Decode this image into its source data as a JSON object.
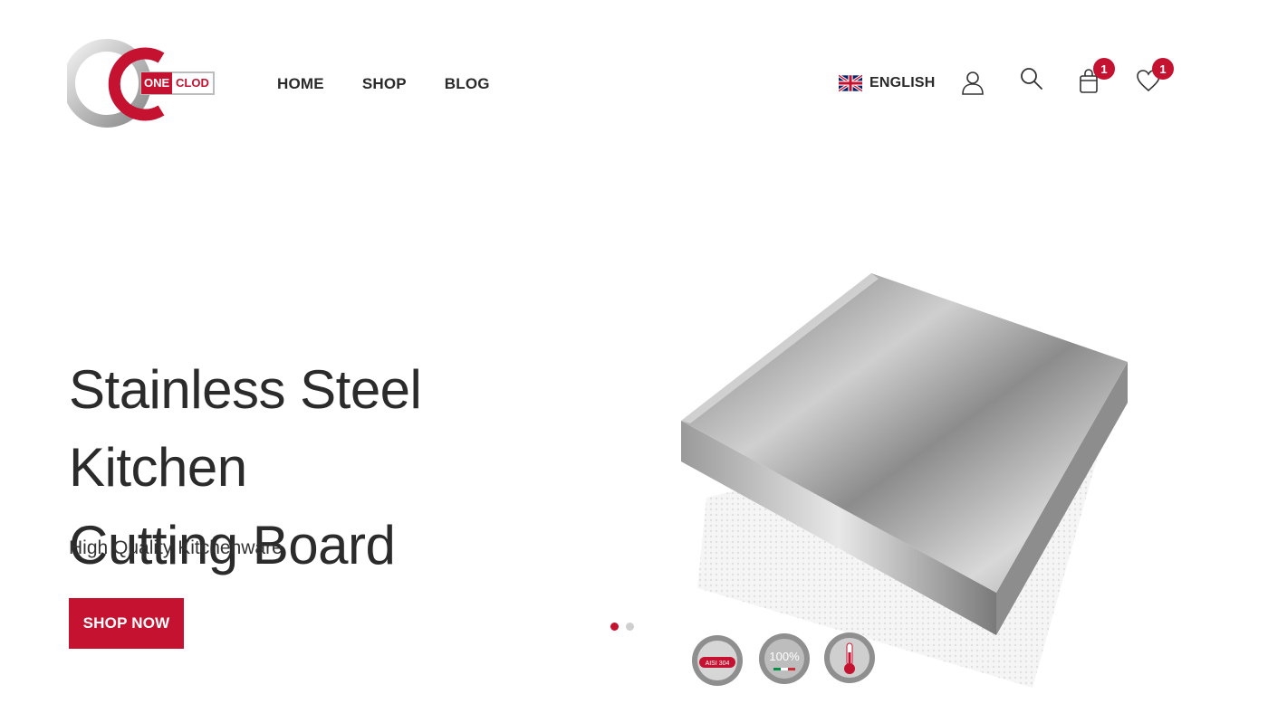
{
  "brand": {
    "logo_word_one": "ONE",
    "logo_word_two": "CLOD",
    "accent_color": "#c41230"
  },
  "nav": {
    "items": [
      {
        "label": "HOME"
      },
      {
        "label": "SHOP"
      },
      {
        "label": "BLOG"
      }
    ]
  },
  "header": {
    "language": {
      "label": "ENGLISH",
      "icon": "uk-flag-icon"
    },
    "user_icon": "user-icon",
    "search_icon": "search-icon",
    "cart": {
      "icon": "shopping-bag-icon",
      "count": "1"
    },
    "wishlist": {
      "icon": "heart-icon",
      "count": "1"
    }
  },
  "hero": {
    "title_line1": "Stainless Steel Kitchen",
    "title_line2": "Cutting Board",
    "subtitle": "High Quality Kitchenware",
    "cta_label": "SHOP NOW",
    "slides_total": 2,
    "active_slide": 1
  },
  "product_badges": [
    {
      "text": "AISI 304"
    },
    {
      "text": "100%"
    },
    {
      "icon": "thermometer-icon"
    }
  ]
}
